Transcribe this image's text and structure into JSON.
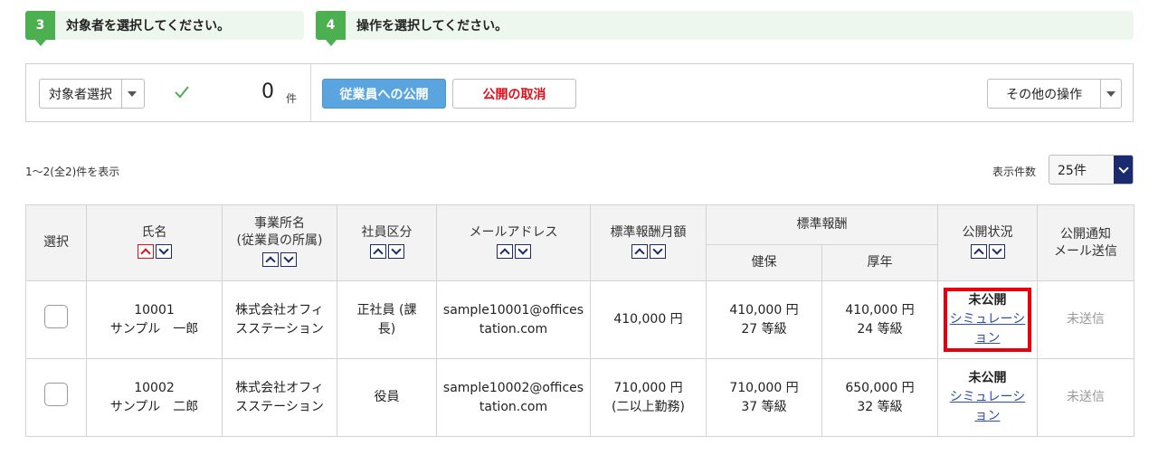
{
  "steps": [
    {
      "num": "3",
      "text": "対象者を選択してください。"
    },
    {
      "num": "4",
      "text": "操作を選択してください。"
    }
  ],
  "toolbar": {
    "target_select_label": "対象者選択",
    "count": "0",
    "count_unit": "件",
    "publish_button": "従業員への公開",
    "unpublish_button": "公開の取消",
    "other_ops_label": "その他の操作"
  },
  "list_info": {
    "range_text": "1〜2(全2)件を表示",
    "per_page_label": "表示件数",
    "per_page_value": "25件"
  },
  "colors": {
    "step_green": "#4caf50",
    "primary_blue": "#5aa5e0",
    "danger_red": "#e0101a",
    "navy": "#1a2a6e",
    "highlight_red": "#e8000e"
  },
  "table": {
    "headers": {
      "select": "選択",
      "name": "氏名",
      "office_line1": "事業所名",
      "office_line2": "(従業員の所属)",
      "employee_type": "社員区分",
      "email": "メールアドレス",
      "monthly_pay": "標準報酬月額",
      "standard_pay": "標準報酬",
      "health": "健保",
      "pension": "厚年",
      "status": "公開状況",
      "notify_line1": "公開通知",
      "notify_line2": "メール送信"
    },
    "rows": [
      {
        "id": "10001",
        "name": "サンプル　一郎",
        "office_line1": "株式会社オフィ",
        "office_line2": "スステーション",
        "type_line1": "正社員 (課",
        "type_line2": "長)",
        "email_line1": "sample10001@offices",
        "email_line2": "tation.com",
        "monthly_line1": "410,000 円",
        "monthly_line2": "",
        "health_amount": "410,000 円",
        "health_grade": "27 等級",
        "pension_amount": "410,000 円",
        "pension_grade": "24 等級",
        "status": "未公開",
        "sim_line1": "シミュレーシ",
        "sim_line2": "ョン",
        "notify": "未送信"
      },
      {
        "id": "10002",
        "name": "サンプル　二郎",
        "office_line1": "株式会社オフィ",
        "office_line2": "スステーション",
        "type_line1": "役員",
        "type_line2": "",
        "email_line1": "sample10002@offices",
        "email_line2": "tation.com",
        "monthly_line1": "710,000 円",
        "monthly_line2": "(二以上勤務)",
        "health_amount": "710,000 円",
        "health_grade": "37 等級",
        "pension_amount": "650,000 円",
        "pension_grade": "32 等級",
        "status": "未公開",
        "sim_line1": "シミュレーシ",
        "sim_line2": "ョン",
        "notify": "未送信"
      }
    ]
  }
}
